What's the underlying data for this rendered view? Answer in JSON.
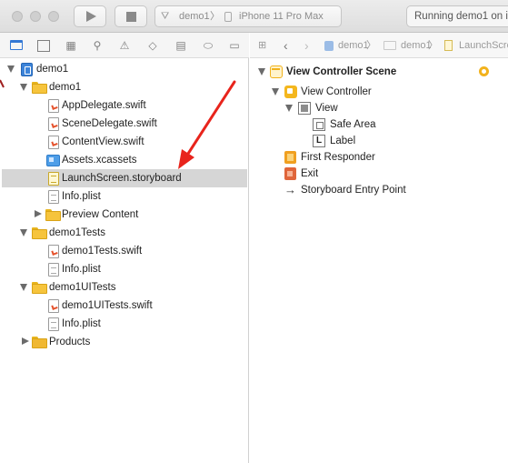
{
  "toolbar": {
    "scheme_target": "demo1",
    "scheme_separator": "〉",
    "scheme_device": "iPhone 11 Pro Max",
    "status": "Running demo1 on i"
  },
  "navigator": {
    "tabs": [
      "folder-icon",
      "source-control-icon",
      "symbol-icon",
      "find-icon",
      "issue-icon",
      "test-icon",
      "debug-icon",
      "breakpoint-icon",
      "report-icon"
    ],
    "items": [
      {
        "label": "demo1",
        "kind": "project",
        "expanded": true
      },
      {
        "label": "demo1",
        "kind": "folder",
        "expanded": true
      },
      {
        "label": "AppDelegate.swift",
        "kind": "swift"
      },
      {
        "label": "SceneDelegate.swift",
        "kind": "swift"
      },
      {
        "label": "ContentView.swift",
        "kind": "swift"
      },
      {
        "label": "Assets.xcassets",
        "kind": "assets"
      },
      {
        "label": "LaunchScreen.storyboard",
        "kind": "storyboard",
        "selected": true
      },
      {
        "label": "Info.plist",
        "kind": "plist"
      },
      {
        "label": "Preview Content",
        "kind": "folder",
        "expanded": false
      },
      {
        "label": "demo1Tests",
        "kind": "folder",
        "expanded": true
      },
      {
        "label": "demo1Tests.swift",
        "kind": "swift"
      },
      {
        "label": "Info.plist",
        "kind": "plist"
      },
      {
        "label": "demo1UITests",
        "kind": "folder",
        "expanded": true
      },
      {
        "label": "demo1UITests.swift",
        "kind": "swift"
      },
      {
        "label": "Info.plist",
        "kind": "plist"
      },
      {
        "label": "Products",
        "kind": "folder",
        "expanded": false
      }
    ]
  },
  "editor": {
    "jump_bar": {
      "crumb_project": "demo1",
      "crumb_folder": "demo1",
      "crumb_file": "LaunchScreen.storyb"
    },
    "outline": [
      {
        "label": "View Controller Scene"
      },
      {
        "label": "View Controller"
      },
      {
        "label": "View"
      },
      {
        "label": "Safe Area"
      },
      {
        "label": "Label"
      },
      {
        "label": "First Responder"
      },
      {
        "label": "Exit"
      },
      {
        "label": "Storyboard Entry Point"
      }
    ]
  },
  "colors": {
    "annotation_arrow": "#e8241c",
    "selection": "#d6d6d6",
    "folder": "#f6c43c"
  }
}
